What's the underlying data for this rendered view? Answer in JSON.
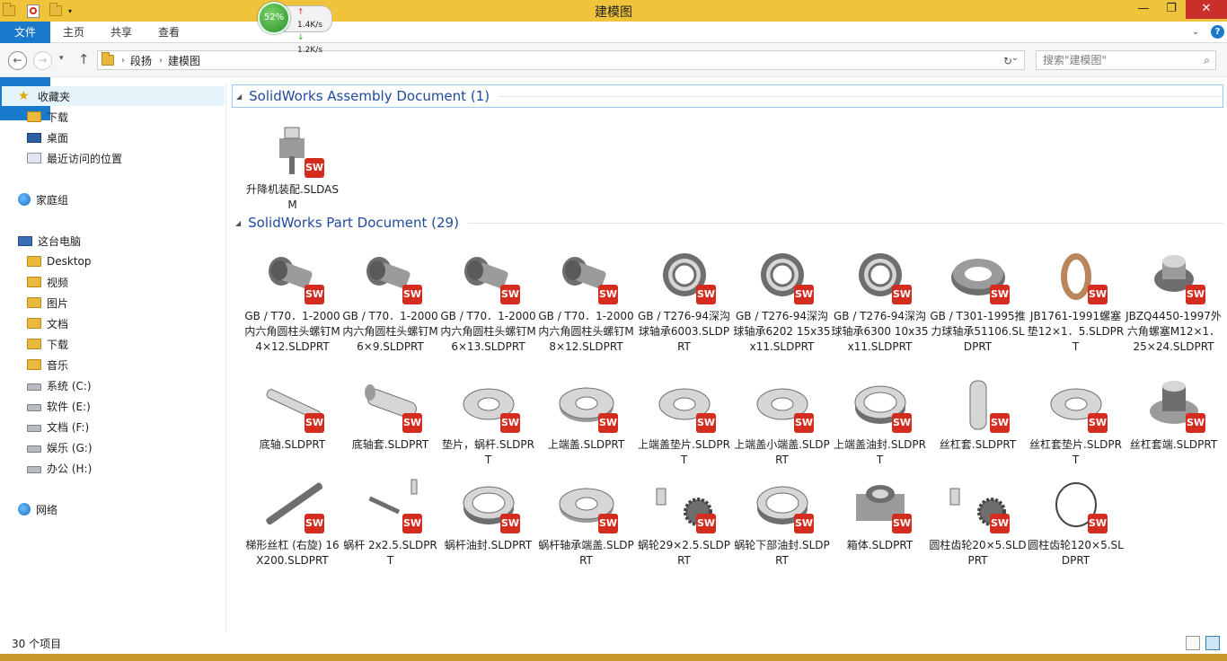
{
  "window": {
    "title": "建模图",
    "minimize": "—",
    "maximize": "❐",
    "close": "✕"
  },
  "network": {
    "percent": "52%",
    "upload": "1.4K/s",
    "download": "1.2K/s"
  },
  "ribbon": {
    "file": "文件",
    "home": "主页",
    "share": "共享",
    "view": "查看",
    "help": "?"
  },
  "address": {
    "crumbs": [
      "段扬",
      "建模图"
    ],
    "search_placeholder": "搜索\"建模图\""
  },
  "nav": {
    "favorites": "收藏夹",
    "fav_items": [
      "下载",
      "桌面",
      "最近访问的位置"
    ],
    "homegroup": "家庭组",
    "thispc": "这台电脑",
    "pc_items": [
      "Desktop",
      "视频",
      "图片",
      "文档",
      "下载",
      "音乐",
      "系统 (C:)",
      "软件 (E:)",
      "文档 (F:)",
      "娱乐 (G:)",
      "办公 (H:)"
    ],
    "network": "网络"
  },
  "groups": [
    {
      "title": "SolidWorks Assembly Document (1)"
    },
    {
      "title": "SolidWorks Part Document (29)"
    }
  ],
  "files": [
    "升降机装配.SLDASM",
    "GB / T70．1-2000内六角圆柱头螺钉M4×12.SLDPRT",
    "GB / T70．1-2000内六角圆柱头螺钉M6×9.SLDPRT",
    "GB / T70．1-2000内六角圆柱头螺钉M6×13.SLDPRT",
    "GB / T70．1-2000内六角圆柱头螺钉M8×12.SLDPRT",
    "GB / T276-94深沟球轴承6003.SLDPRT",
    "GB / T276-94深沟球轴承6202 15x35x11.SLDPRT",
    "GB / T276-94深沟球轴承6300 10x35x11.SLDPRT",
    "GB / T301-1995推力球轴承51106.SLDPRT",
    "JB1761-1991螺塞垫12×1．5.SLDPRT",
    "JBZQ4450-1997外六角螺塞M12×1．25×24.SLDPRT",
    "底轴.SLDPRT",
    "底轴套.SLDPRT",
    "垫片，蜗杆.SLDPRT",
    "上端盖.SLDPRT",
    "上端盖垫片.SLDPRT",
    "上端盖小端盖.SLDPRT",
    "上端盖油封.SLDPRT",
    "丝杠套.SLDPRT",
    "丝杠套垫片.SLDPRT",
    "丝杠套端.SLDPRT",
    "梯形丝杠 (右旋) 16X200.SLDPRT",
    "蜗杆 2x2.5.SLDPRT",
    "蜗杆油封.SLDPRT",
    "蜗杆轴承端盖.SLDPRT",
    "蜗轮29×2.5.SLDPRT",
    "蜗轮下部油封.SLDPRT",
    "箱体.SLDPRT",
    "圆柱齿轮20×5.SLDPRT",
    "圆柱齿轮120×5.SLDPRT"
  ],
  "sw_badge": "SW",
  "status": {
    "count": "30 个项目"
  }
}
